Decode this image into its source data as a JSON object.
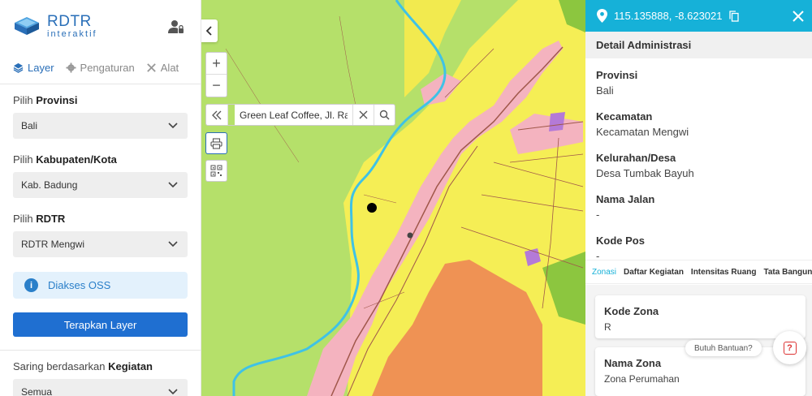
{
  "brand": {
    "title": "RDTR",
    "subtitle": "interaktif"
  },
  "tabs": [
    {
      "label": "Layer",
      "icon": "layers-icon",
      "active": true
    },
    {
      "label": "Pengaturan",
      "icon": "gear-icon",
      "active": false
    },
    {
      "label": "Alat",
      "icon": "tools-icon",
      "active": false
    }
  ],
  "filters": {
    "provinsi": {
      "label_prefix": "Pilih",
      "label_bold": "Provinsi",
      "value": "Bali"
    },
    "kabupaten": {
      "label_prefix": "Pilih",
      "label_bold": "Kabupaten/Kota",
      "value": "Kab. Badung"
    },
    "rdtr": {
      "label_prefix": "Pilih",
      "label_bold": "RDTR",
      "value": "RDTR Mengwi"
    }
  },
  "oss": {
    "label": "Diakses OSS"
  },
  "apply_button": "Terapkan Layer",
  "kegiatan": {
    "label_prefix": "Saring berdasarkan",
    "label_bold": "Kegiatan",
    "value": "Semua"
  },
  "map": {
    "search_value": "Green Leaf Coffee, Jl. Raya",
    "colors": {
      "green_zone": "#b5e06a",
      "yellow_zone": "#f5ee55",
      "pink_zone": "#f4b3bf",
      "orange_zone": "#ef9254",
      "purple_zone": "#b47ad7",
      "river": "#3fc2e6",
      "road": "#a0574a"
    }
  },
  "panel": {
    "coordinates": "115.135888, -8.623021",
    "detail_title": "Detail Administrasi",
    "details": [
      {
        "key": "Provinsi",
        "value": "Bali"
      },
      {
        "key": "Kecamatan",
        "value": "Kecamatan Mengwi"
      },
      {
        "key": "Kelurahan/Desa",
        "value": "Desa Tumbak Bayuh"
      },
      {
        "key": "Nama Jalan",
        "value": "-"
      },
      {
        "key": "Kode Pos",
        "value": "-"
      }
    ],
    "zone_tabs": [
      {
        "label": "Zonasi",
        "active": true
      },
      {
        "label": "Daftar Kegiatan",
        "active": false
      },
      {
        "label": "Intensitas Ruang",
        "active": false
      },
      {
        "label": "Tata Bangunan",
        "active": false
      }
    ],
    "kode_zona": {
      "key": "Kode Zona",
      "value": "R"
    },
    "nama_zona": {
      "key": "Nama Zona",
      "value": "Zona Perumahan"
    }
  },
  "help": {
    "label": "Butuh Bantuan?",
    "icon_text": "?"
  },
  "colors": {
    "accent": "#16b1d8",
    "primary_button": "#1f6fd1",
    "brand": "#2a6fb8"
  }
}
